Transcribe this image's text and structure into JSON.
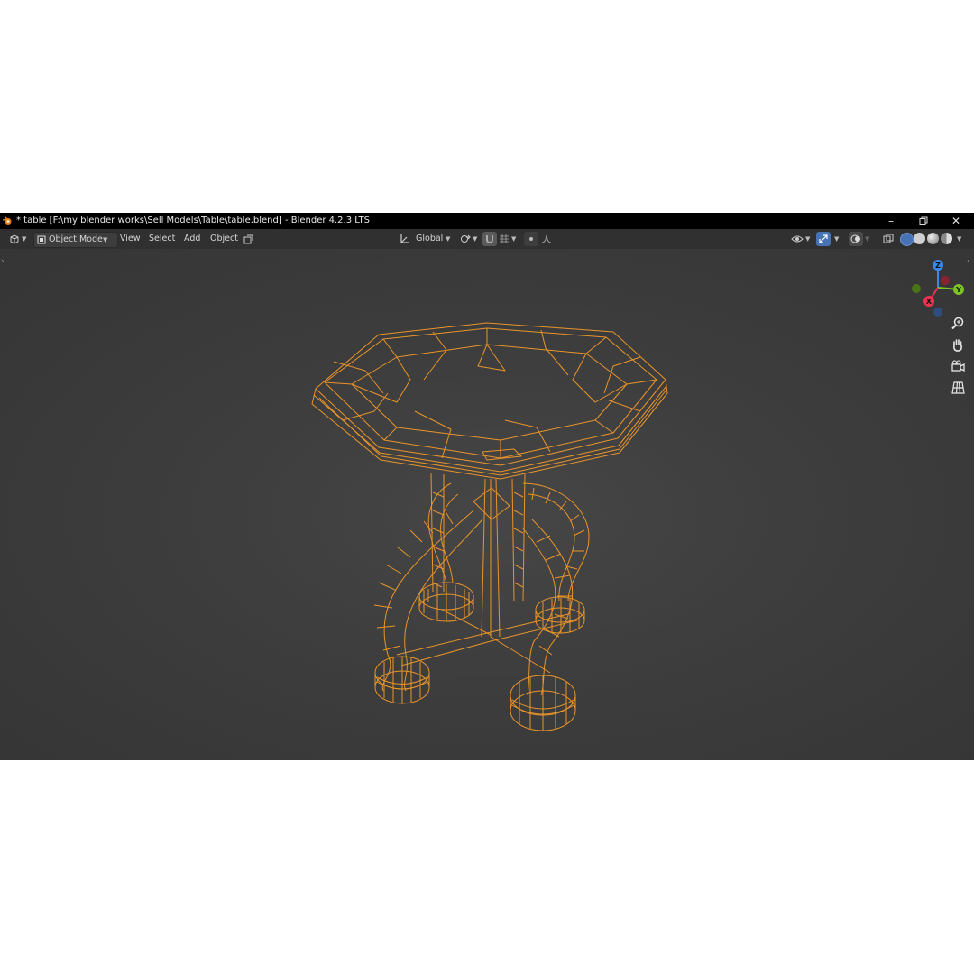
{
  "window": {
    "title": "* table [F:\\my blender works\\Sell Models\\Table\\table.blend] - Blender 4.2.3 LTS",
    "controls": [
      "minimize-icon",
      "restore-icon",
      "close-icon"
    ]
  },
  "header": {
    "editor_type_icon": "viewport-3d-icon",
    "mode": "Object Mode",
    "menus": [
      "View",
      "Select",
      "Add",
      "Object"
    ],
    "transform_orientation": "Global",
    "icons_center": [
      "pivot-icon",
      "snap-icon",
      "snap-target-icon",
      "proportional-edit-icon",
      "falloff-icon"
    ],
    "icons_right": [
      "visibility-icon",
      "gizmo-icon",
      "overlay-icon",
      "xray-icon",
      "wireframe-shading-icon",
      "solid-shading-icon",
      "material-shading-icon",
      "rendered-shading-icon"
    ]
  },
  "gizmo": {
    "axes": [
      "Z",
      "Y",
      "X"
    ],
    "colors": {
      "x": "#e8344f",
      "y": "#7dc225",
      "z": "#3b88e8"
    }
  },
  "nav_buttons": [
    "zoom-icon",
    "pan-hand-icon",
    "camera-view-icon",
    "ortho-grid-icon"
  ],
  "colors": {
    "wire": "#e8942a",
    "viewport_bg": "#3d3d3d",
    "header_bg": "#303030",
    "titlebar_bg": "#000000"
  }
}
